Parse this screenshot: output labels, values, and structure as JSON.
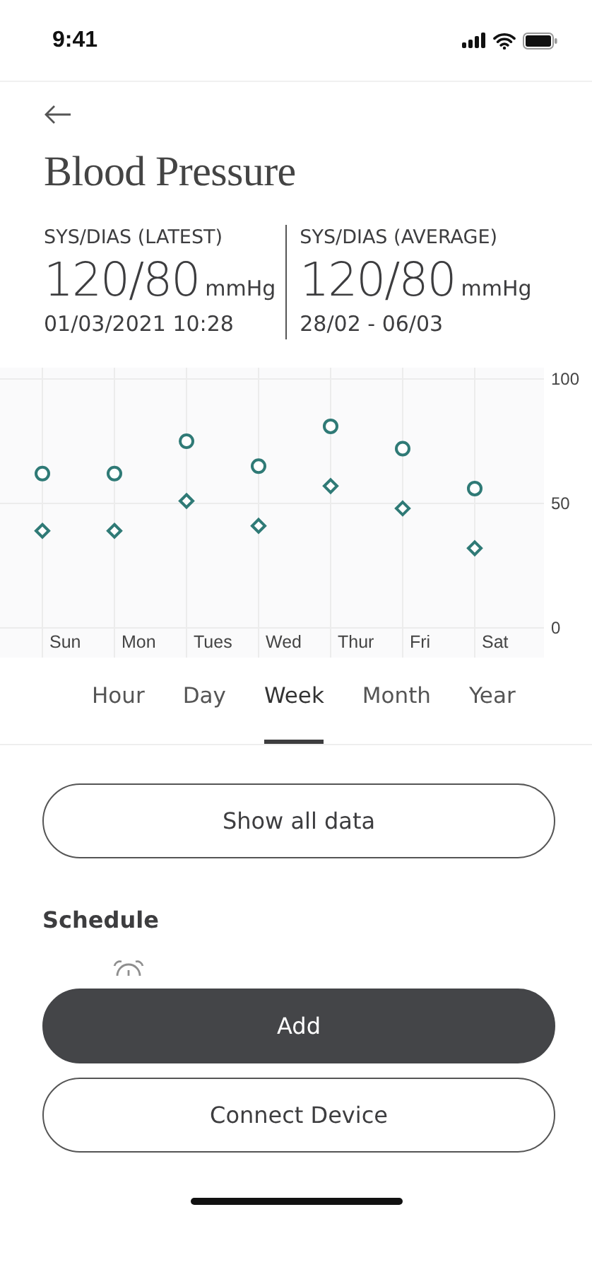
{
  "status_bar": {
    "time": "9:41"
  },
  "header": {
    "title": "Blood Pressure"
  },
  "stats": [
    {
      "label": "SYS/DIAS (LATEST)",
      "value": "120/80",
      "unit": "mmHg",
      "detail": "01/03/2021 10:28"
    },
    {
      "label": "SYS/DIAS (AVERAGE)",
      "value": "120/80",
      "unit": "mmHg",
      "detail": "28/02 - 06/03"
    }
  ],
  "chart": {
    "chart_data": {
      "type": "scatter",
      "categories": [
        "Sun",
        "Mon",
        "Tues",
        "Wed",
        "Thur",
        "Fri",
        "Sat"
      ],
      "ylim": [
        0,
        100
      ],
      "yticks": [
        0,
        50,
        100
      ],
      "series": [
        {
          "color": "#2f7a76",
          "values": [
            62,
            62,
            75,
            65,
            81,
            72,
            56
          ]
        },
        {
          "color": "#2f7a76",
          "values": [
            39,
            39,
            51,
            41,
            57,
            48,
            32
          ]
        }
      ]
    }
  },
  "period_tabs": [
    {
      "label": "Hour",
      "selected": false
    },
    {
      "label": "Day",
      "selected": false
    },
    {
      "label": "Week",
      "selected": true
    },
    {
      "label": "Month",
      "selected": false
    },
    {
      "label": "Year",
      "selected": false
    }
  ],
  "show_all_button": "Show all data",
  "schedule": {
    "title": "Schedule"
  },
  "buttons": [
    {
      "label": "Add",
      "kind": "primary"
    },
    {
      "label": "Connect Device",
      "kind": "secondary"
    }
  ]
}
